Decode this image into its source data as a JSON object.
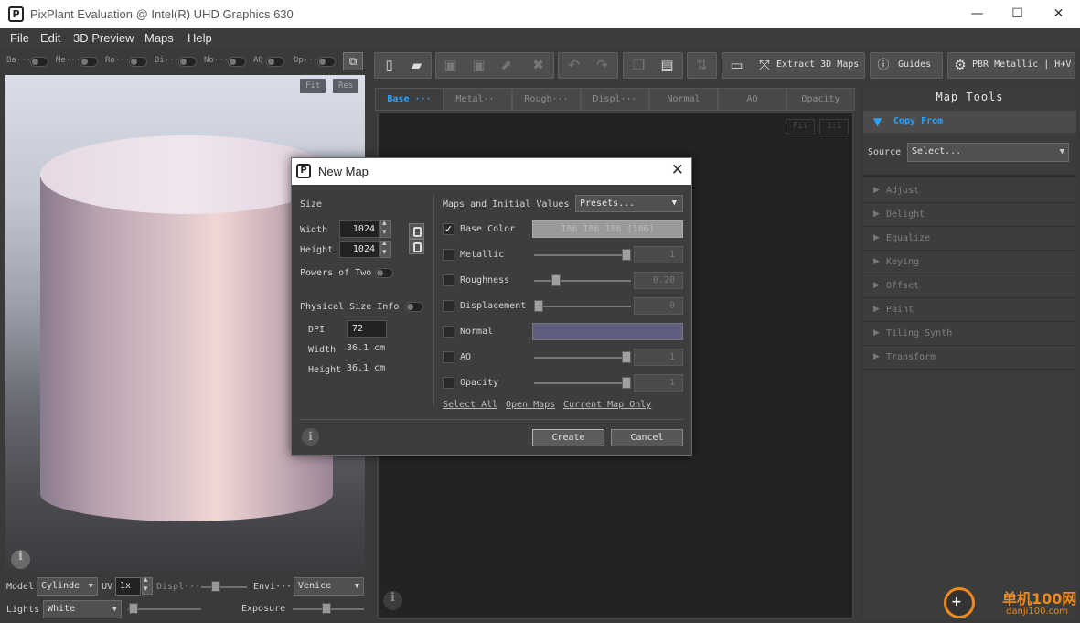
{
  "window": {
    "title": "PixPlant Evaluation @ Intel(R) UHD Graphics 630",
    "minimize": "—",
    "maximize": "☐",
    "close": "✕"
  },
  "menu": [
    "File",
    "Edit",
    "3D Preview",
    "Maps",
    "Help"
  ],
  "left_toggles": [
    "Ba···",
    "Me···",
    "Ro···",
    "Di···",
    "No···",
    "AO",
    "Op···"
  ],
  "toolbar": {
    "extract_label": "Extract 3D Maps",
    "guides_label": "Guides",
    "pbr_label": "PBR Metallic | H+V"
  },
  "viewport3d": {
    "fit": "Fit",
    "res": "Res"
  },
  "left_bottom": {
    "model_label": "Model",
    "model_value": "Cylinde",
    "uv_label": "UV",
    "uv_value": "1x",
    "displ_label": "Displ···",
    "envi_label": "Envi···",
    "envi_value": "Venice",
    "lights_label": "Lights",
    "lights_value": "White",
    "exposure_label": "Exposure"
  },
  "tabs": [
    "Base ···",
    "Metal···",
    "Rough···",
    "Displ···",
    "Normal",
    "AO",
    "Opacity"
  ],
  "canvas": {
    "fit": "Fit",
    "one_to_one": "1:1"
  },
  "map_tools": {
    "title": "Map Tools",
    "copy_from": "Copy From",
    "source_label": "Source",
    "source_value": "Select...",
    "items": [
      "Adjust",
      "Delight",
      "Equalize",
      "Keying",
      "Offset",
      "Paint",
      "Tiling Synth",
      "Transform"
    ]
  },
  "dialog": {
    "title": "New Map",
    "size_heading": "Size",
    "width_label": "Width",
    "width_value": "1024",
    "height_label": "Height",
    "height_value": "1024",
    "powers_of_two": "Powers of Two",
    "physical_size_info": "Physical Size Info",
    "dpi_label": "DPI",
    "dpi_value": "72",
    "phys_width_label": "Width",
    "phys_width_value": "36.1 cm",
    "phys_height_label": "Height",
    "phys_height_value": "36.1 cm",
    "maps_heading": "Maps and Initial Values",
    "presets": "Presets...",
    "maps": [
      {
        "label": "Base Color",
        "checked": "✓",
        "value": "186 186 186 (186)",
        "slider": null
      },
      {
        "label": "Metallic",
        "checked": "",
        "value": "1",
        "slider": 1.0
      },
      {
        "label": "Roughness",
        "checked": "",
        "value": "0.20",
        "slider": 0.2
      },
      {
        "label": "Displacement",
        "checked": "",
        "value": "0",
        "slider": 0.0
      },
      {
        "label": "Normal",
        "checked": "",
        "value": "",
        "slider": null
      },
      {
        "label": "AO",
        "checked": "",
        "value": "1",
        "slider": 1.0
      },
      {
        "label": "Opacity",
        "checked": "",
        "value": "1",
        "slider": 1.0
      }
    ],
    "normal_color": "#5f5d80",
    "select_all": "Select All",
    "open_maps": "Open Maps",
    "current_map_only": "Current Map Only",
    "create": "Create",
    "cancel": "Cancel"
  },
  "watermark": {
    "text": "单机100网",
    "url": "danji100.com"
  },
  "colors": {
    "accent": "#29a3ff",
    "background": "#3a3a3a",
    "canvas": "#232323"
  }
}
